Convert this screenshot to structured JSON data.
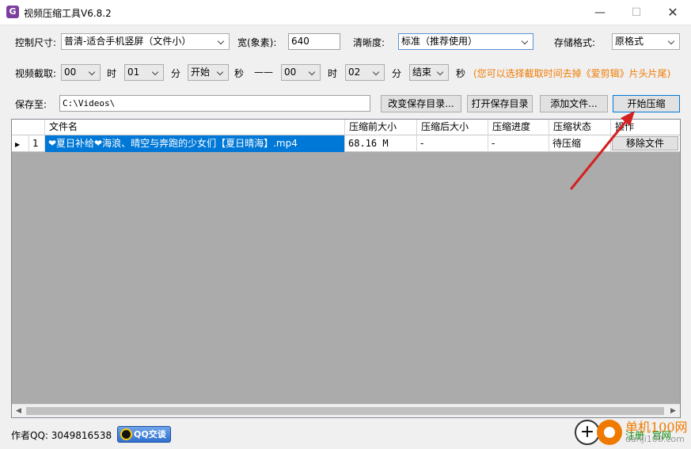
{
  "window": {
    "app_icon_letter": "G",
    "title": "视频压缩工具V6.8.2",
    "min_glyph": "—",
    "max_glyph": "☐",
    "close_glyph": "✕"
  },
  "row1": {
    "size_label": "控制尺寸:",
    "size_value": "普清-适合手机竖屏（文件小）",
    "width_label": "宽(象素):",
    "width_value": "640",
    "clarity_label": "清晰度:",
    "clarity_value": "标准（推荐使用）",
    "format_label": "存储格式:",
    "format_value": "原格式"
  },
  "row2": {
    "clip_label": "视频截取:",
    "start_hour": "00",
    "hour_label": "时",
    "start_min": "01",
    "min_label": "分",
    "start_sec": "开始",
    "sec_label": "秒",
    "dash": "——",
    "end_hour": "00",
    "hour_label2": "时",
    "end_min": "02",
    "min_label2": "分",
    "end_sec": "结束",
    "sec_label2": "秒",
    "hint": "(您可以选择截取时间去掉《爱剪辑》片头片尾)"
  },
  "row3": {
    "save_label": "保存至:",
    "save_path": "C:\\Videos\\",
    "change_dir": "改变保存目录...",
    "open_dir": "打开保存目录",
    "add_file": "添加文件...",
    "start": "开始压缩"
  },
  "table": {
    "columns": [
      "文件名",
      "压缩前大小",
      "压缩后大小",
      "压缩进度",
      "压缩状态",
      "操作"
    ],
    "rows": [
      {
        "indicator": "▶",
        "index": "1",
        "filename": "❤夏日补给❤海浪、晴空与奔跑的少女们【夏日晴海】.mp4",
        "size_before": "68.16 M",
        "size_after": "-",
        "progress": "-",
        "status": "待压缩",
        "action": "移除文件"
      }
    ]
  },
  "footer": {
    "author_qq": "作者QQ: 3049816538",
    "qq_badge": "QQ交谈",
    "register": "注册",
    "website": "官网"
  },
  "watermark": {
    "name": "单机100网",
    "url": "danji100.com"
  },
  "colors": {
    "accent": "#0078d7",
    "hint": "#f07a00",
    "pointer_arrow": "#d42020"
  }
}
